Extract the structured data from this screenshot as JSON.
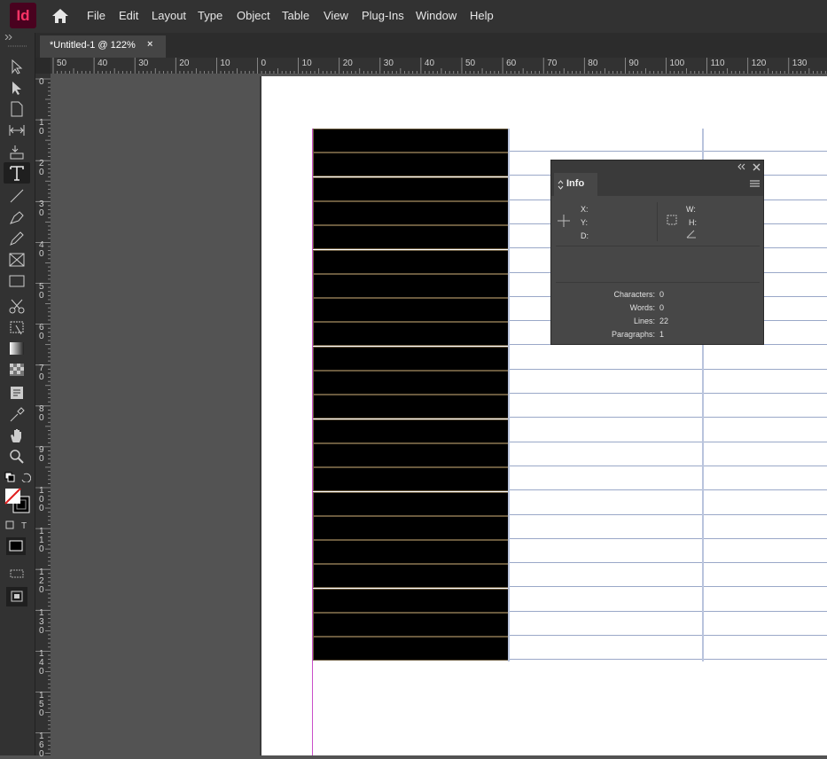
{
  "app": {
    "logo": "Id"
  },
  "menu": {
    "items": [
      "File",
      "Edit",
      "Layout",
      "Type",
      "Object",
      "Table",
      "View",
      "Plug-Ins",
      "Window",
      "Help"
    ]
  },
  "document": {
    "tab_title": "*Untitled-1 @ 122%",
    "close_glyph": "×"
  },
  "ruler": {
    "horizontal": [
      "50",
      "40",
      "30",
      "20",
      "10",
      "0",
      "10",
      "20",
      "30",
      "40",
      "50",
      "60",
      "70",
      "80",
      "90",
      "100",
      "110",
      "120",
      "130"
    ],
    "vertical": [
      "0",
      "10",
      "20",
      "30",
      "40",
      "50",
      "60",
      "70",
      "80",
      "90",
      "100",
      "110",
      "120",
      "130",
      "140",
      "150",
      "160"
    ]
  },
  "table": {
    "rows": 22
  },
  "info_panel": {
    "tab_label": "Info",
    "labels": {
      "x": "X:",
      "y": "Y:",
      "d": "D:",
      "w": "W:",
      "h": "H:"
    },
    "stats": [
      {
        "label": "Characters:",
        "value": "0"
      },
      {
        "label": "Words:",
        "value": "0"
      },
      {
        "label": "Lines:",
        "value": "22"
      },
      {
        "label": "Paragraphs:",
        "value": "1"
      }
    ]
  },
  "colors": {
    "accent": "#ff3366",
    "margin_guide": "#c94fc9"
  },
  "icons": [
    "home-icon",
    "selection-tool-icon",
    "direct-selection-tool-icon",
    "page-tool-icon",
    "gap-tool-icon",
    "content-collector-icon",
    "type-tool-icon",
    "line-tool-icon",
    "pen-tool-icon",
    "pencil-tool-icon",
    "rectangle-frame-icon",
    "rectangle-tool-icon",
    "scissors-icon",
    "free-transform-icon",
    "gradient-swatch-icon",
    "gradient-feather-icon",
    "note-tool-icon",
    "eyedropper-icon",
    "hand-tool-icon",
    "zoom-tool-icon",
    "fill-stroke-icon",
    "screen-mode-icon"
  ]
}
